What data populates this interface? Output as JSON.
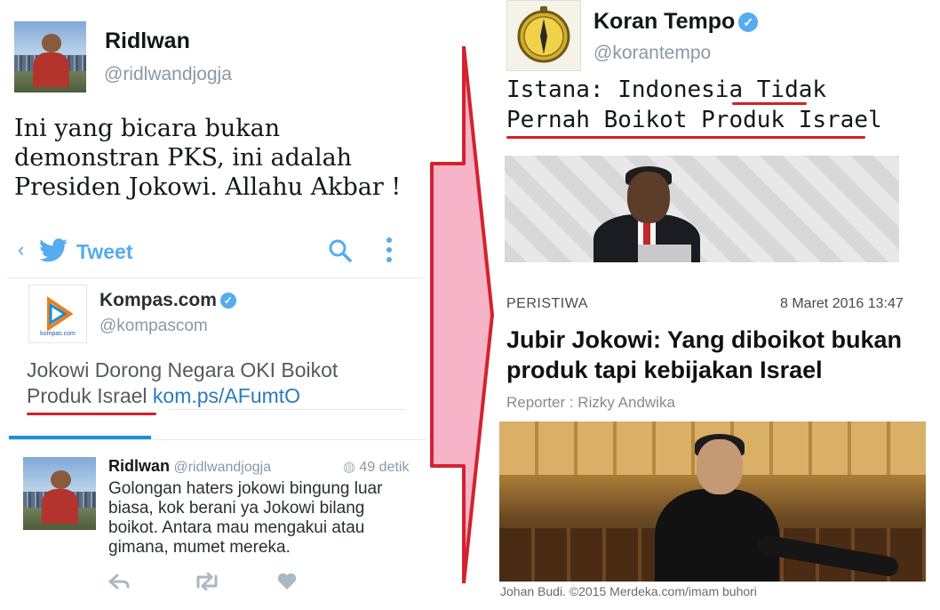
{
  "left": {
    "tweet": {
      "name": "Ridlwan",
      "handle": "@ridlwandjogja",
      "text": "Ini yang bicara bukan demonstran PKS, ini adalah Presiden Jokowi. Allahu Akbar !"
    },
    "screenshot": {
      "back_icon": "chevron-left-icon",
      "header_label": "Tweet",
      "quoted": {
        "name": "Kompas.com",
        "handle": "@kompascom",
        "text_before": "Jokowi Dorong Negara OKI Boikot ",
        "text_underlined": "Produk Israel",
        "link": "kom.ps/AFumtO"
      },
      "reply": {
        "name": "Ridlwan",
        "handle": "@ridlwandjogja",
        "time": "49 detik",
        "text": "Golongan haters jokowi bingung luar biasa, kok berani ya Jokowi bilang boikot. Antara mau mengakui atau gimana, mumet mereka."
      }
    }
  },
  "right": {
    "account": {
      "name": "Koran Tempo",
      "handle": "@korantempo"
    },
    "headline": {
      "line1_before": "Istana: Indonesia ",
      "line1_underlined": "Tidak",
      "line2_underlined": "Pernah Boikot Produk Israel"
    },
    "article": {
      "category": "PERISTIWA",
      "datetime": "8 Maret 2016 13:47",
      "title": "Jubir Jokowi: Yang diboikot bukan produk tapi kebijakan Israel",
      "reporter": "Reporter : Rizky Andwika",
      "caption": "Johan Budi. ©2015 Merdeka.com/imam buhori"
    }
  },
  "colors": {
    "twitter_blue": "#55acee",
    "underline_red": "#d61f26",
    "arrow_pink": "#f7b3c8",
    "arrow_outline": "#d3232e"
  }
}
